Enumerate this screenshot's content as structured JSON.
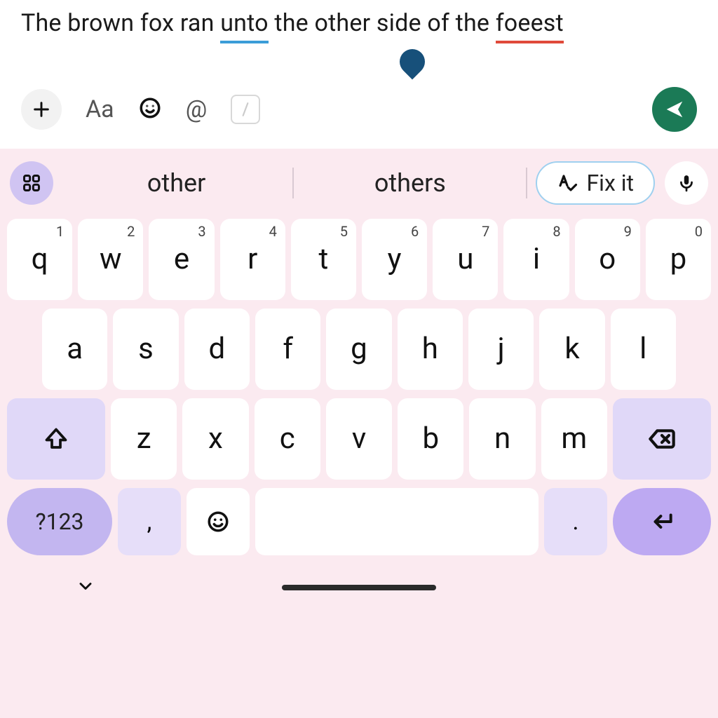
{
  "input": {
    "prefix": "The brown fox ran ",
    "word_unto": "unto",
    "mid": " the other side of the ",
    "word_foeest": "foeest"
  },
  "toolbar": {
    "aa": "Aa",
    "at": "@"
  },
  "suggestions": {
    "item1": "other",
    "item2": "others",
    "fix_label": "Fix it"
  },
  "keys": {
    "row1": [
      {
        "k": "q",
        "s": "1"
      },
      {
        "k": "w",
        "s": "2"
      },
      {
        "k": "e",
        "s": "3"
      },
      {
        "k": "r",
        "s": "4"
      },
      {
        "k": "t",
        "s": "5"
      },
      {
        "k": "y",
        "s": "6"
      },
      {
        "k": "u",
        "s": "7"
      },
      {
        "k": "i",
        "s": "8"
      },
      {
        "k": "o",
        "s": "9"
      },
      {
        "k": "p",
        "s": "0"
      }
    ],
    "row2": [
      "a",
      "s",
      "d",
      "f",
      "g",
      "h",
      "j",
      "k",
      "l"
    ],
    "row3": [
      "z",
      "x",
      "c",
      "v",
      "b",
      "n",
      "m"
    ],
    "sym": "?123",
    "comma": ",",
    "period": "."
  }
}
